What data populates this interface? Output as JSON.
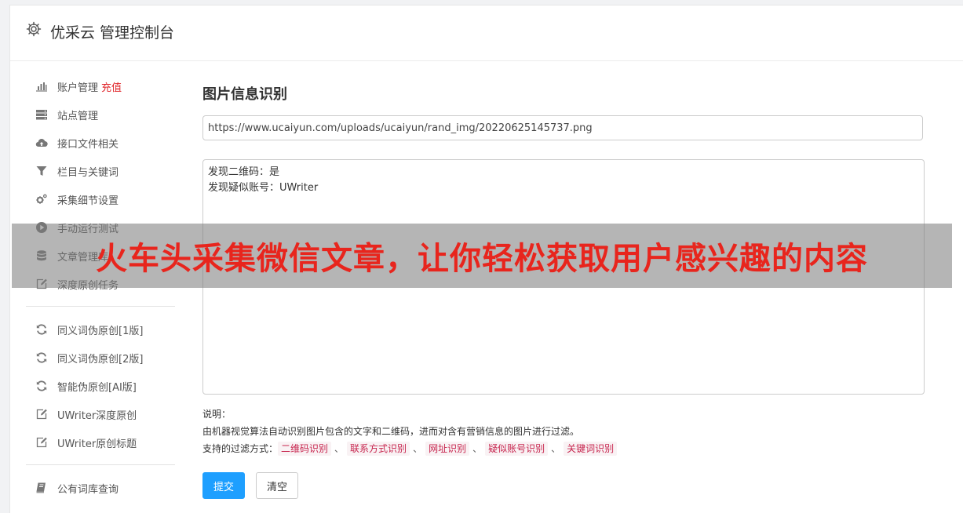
{
  "header": {
    "title": "优采云 管理控制台"
  },
  "sidebar": {
    "group1": [
      {
        "label": "账户管理",
        "badge": "充值",
        "icon": "bar-chart-icon"
      },
      {
        "label": "站点管理",
        "icon": "server-icon"
      },
      {
        "label": "接口文件相关",
        "icon": "cloud-upload-icon"
      },
      {
        "label": "栏目与关键词",
        "icon": "filter-icon"
      },
      {
        "label": "采集细节设置",
        "icon": "cogs-icon"
      },
      {
        "label": "手动运行测试",
        "icon": "play-circle-icon"
      },
      {
        "label": "文章管理库",
        "icon": "database-icon"
      },
      {
        "label": "深度原创任务",
        "icon": "edit-icon"
      }
    ],
    "group2": [
      {
        "label": "同义词伪原创[1版]",
        "icon": "refresh-icon"
      },
      {
        "label": "同义词伪原创[2版]",
        "icon": "refresh-icon"
      },
      {
        "label": "智能伪原创[AI版]",
        "icon": "refresh-icon"
      },
      {
        "label": "UWriter深度原创",
        "icon": "edit-icon"
      },
      {
        "label": "UWriter原创标题",
        "icon": "edit-icon"
      }
    ],
    "group3": [
      {
        "label": "公有词库查询",
        "icon": "book-icon"
      }
    ]
  },
  "main": {
    "section_title": "图片信息识别",
    "url_value": "https://www.ucaiyun.com/uploads/ucaiyun/rand_img/20220625145737.png",
    "result_lines": [
      "发现二维码：是",
      "发现疑似账号：UWriter"
    ],
    "notes": {
      "label": "说明：",
      "desc": "由机器视觉算法自动识别图片包含的文字和二维码，进而对含有营销信息的图片进行过滤。",
      "filter_prefix": "支持的过滤方式：",
      "filters": [
        "二维码识别",
        "联系方式识别",
        "网址识别",
        "疑似账号识别",
        "关键词识别"
      ],
      "separator": "、"
    },
    "submit_label": "提交",
    "clear_label": "清空"
  },
  "overlay": {
    "text": "火车头采集微信文章，让你轻松获取用户感兴趣的内容"
  },
  "colors": {
    "accent": "#1e9fff",
    "badge": "#e0252a",
    "overlay_text": "#e8251d",
    "tag_text": "#c7254e",
    "tag_bg": "#f9f2f4"
  }
}
